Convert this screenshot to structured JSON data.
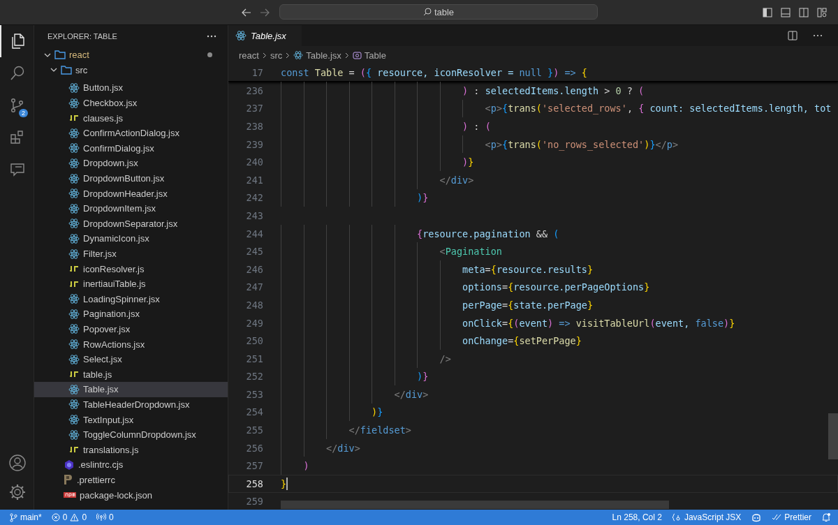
{
  "title_bar": {
    "search": {
      "value": "table"
    }
  },
  "activity_bar": {
    "items": [
      {
        "kind": "explorer",
        "selected": true
      },
      {
        "kind": "search",
        "selected": false
      },
      {
        "kind": "scm",
        "selected": false,
        "badge": "2"
      },
      {
        "kind": "extensions",
        "selected": false
      },
      {
        "kind": "remote",
        "selected": false
      }
    ],
    "bottom": [
      {
        "kind": "account"
      },
      {
        "kind": "settings"
      }
    ]
  },
  "sidebar": {
    "title": "EXPLORER: TABLE",
    "tree": [
      {
        "name": "react",
        "kind": "folder",
        "expanded": true,
        "modified": true,
        "selected": false,
        "children": [
          {
            "name": "src",
            "kind": "folder",
            "expanded": true,
            "selected": false,
            "children": [
              {
                "name": "Button.jsx",
                "kind": "react",
                "selected": false
              },
              {
                "name": "Checkbox.jsx",
                "kind": "react",
                "selected": false
              },
              {
                "name": "clauses.js",
                "kind": "js",
                "selected": false
              },
              {
                "name": "ConfirmActionDialog.jsx",
                "kind": "react",
                "selected": false
              },
              {
                "name": "ConfirmDialog.jsx",
                "kind": "react",
                "selected": false
              },
              {
                "name": "Dropdown.jsx",
                "kind": "react",
                "selected": false
              },
              {
                "name": "DropdownButton.jsx",
                "kind": "react",
                "selected": false
              },
              {
                "name": "DropdownHeader.jsx",
                "kind": "react",
                "selected": false
              },
              {
                "name": "DropdownItem.jsx",
                "kind": "react",
                "selected": false
              },
              {
                "name": "DropdownSeparator.jsx",
                "kind": "react",
                "selected": false
              },
              {
                "name": "DynamicIcon.jsx",
                "kind": "react",
                "selected": false
              },
              {
                "name": "Filter.jsx",
                "kind": "react",
                "selected": false
              },
              {
                "name": "iconResolver.js",
                "kind": "js",
                "selected": false
              },
              {
                "name": "inertiauiTable.js",
                "kind": "js",
                "selected": false
              },
              {
                "name": "LoadingSpinner.jsx",
                "kind": "react",
                "selected": false
              },
              {
                "name": "Pagination.jsx",
                "kind": "react",
                "selected": false
              },
              {
                "name": "Popover.jsx",
                "kind": "react",
                "selected": false
              },
              {
                "name": "RowActions.jsx",
                "kind": "react",
                "selected": false
              },
              {
                "name": "Select.jsx",
                "kind": "react",
                "selected": false
              },
              {
                "name": "table.js",
                "kind": "js",
                "selected": false
              },
              {
                "name": "Table.jsx",
                "kind": "react",
                "selected": true
              },
              {
                "name": "TableHeaderDropdown.jsx",
                "kind": "react",
                "selected": false
              },
              {
                "name": "TextInput.jsx",
                "kind": "react",
                "selected": false
              },
              {
                "name": "ToggleColumnDropdown.jsx",
                "kind": "react",
                "selected": false
              },
              {
                "name": "translations.js",
                "kind": "js",
                "selected": false
              }
            ]
          },
          {
            "name": ".eslintrc.cjs",
            "kind": "eslint",
            "selected": false
          },
          {
            "name": ".prettierrc",
            "kind": "prettier",
            "selected": false
          },
          {
            "name": "package-lock.json",
            "kind": "npm",
            "selected": false
          }
        ]
      }
    ]
  },
  "editor": {
    "tabs": [
      {
        "label": "Table.jsx",
        "kind": "react",
        "selected": true
      }
    ],
    "breadcrumbs": [
      {
        "label": "react",
        "kind": "folder"
      },
      {
        "label": "src",
        "kind": "folder"
      },
      {
        "label": "Table.jsx",
        "kind": "react"
      },
      {
        "label": "Table",
        "kind": "symbol"
      }
    ],
    "sticky_line": {
      "number": "17",
      "tokens": [
        {
          "t": "const ",
          "kind": "kw"
        },
        {
          "t": "Table",
          "kind": "fn"
        },
        {
          "t": " = ",
          "kind": "plain"
        },
        {
          "t": "(",
          "kind": "b2"
        },
        {
          "t": "{",
          "kind": "b3"
        },
        {
          "t": " resource, iconResolver = ",
          "kind": "var"
        },
        {
          "t": "null ",
          "kind": "kw"
        },
        {
          "t": "}",
          "kind": "b3"
        },
        {
          "t": ")",
          "kind": "b2"
        },
        {
          "t": " => ",
          "kind": "kw"
        },
        {
          "t": "{",
          "kind": "b1"
        }
      ]
    },
    "lines": [
      {
        "number": "236",
        "current": false,
        "tokens": [
          {
            "t": "                                )",
            "kind": "b2"
          },
          {
            "t": " : ",
            "kind": "plain"
          },
          {
            "t": "selectedItems.length",
            "kind": "var"
          },
          {
            "t": " > ",
            "kind": "plain"
          },
          {
            "t": "0",
            "kind": "num"
          },
          {
            "t": " ? ",
            "kind": "plain"
          },
          {
            "t": "(",
            "kind": "b2"
          }
        ]
      },
      {
        "number": "237",
        "current": false,
        "tokens": [
          {
            "t": "                                    <",
            "kind": "tag"
          },
          {
            "t": "p",
            "kind": "kw"
          },
          {
            "t": ">",
            "kind": "tag"
          },
          {
            "t": "{",
            "kind": "b3"
          },
          {
            "t": "trans",
            "kind": "fn"
          },
          {
            "t": "(",
            "kind": "b1"
          },
          {
            "t": "'selected_rows'",
            "kind": "str"
          },
          {
            "t": ", ",
            "kind": "plain"
          },
          {
            "t": "{",
            "kind": "b2"
          },
          {
            "t": " count: selectedItems.length, tot",
            "kind": "var"
          }
        ]
      },
      {
        "number": "238",
        "current": false,
        "tokens": [
          {
            "t": "                                )",
            "kind": "b2"
          },
          {
            "t": " : ",
            "kind": "plain"
          },
          {
            "t": "(",
            "kind": "b2"
          }
        ]
      },
      {
        "number": "239",
        "current": false,
        "tokens": [
          {
            "t": "                                    <",
            "kind": "tag"
          },
          {
            "t": "p",
            "kind": "kw"
          },
          {
            "t": ">",
            "kind": "tag"
          },
          {
            "t": "{",
            "kind": "b3"
          },
          {
            "t": "trans",
            "kind": "fn"
          },
          {
            "t": "(",
            "kind": "b1"
          },
          {
            "t": "'no_rows_selected'",
            "kind": "str"
          },
          {
            "t": ")",
            "kind": "b1"
          },
          {
            "t": "}",
            "kind": "b3"
          },
          {
            "t": "</",
            "kind": "tag"
          },
          {
            "t": "p",
            "kind": "kw"
          },
          {
            "t": ">",
            "kind": "tag"
          }
        ]
      },
      {
        "number": "240",
        "current": false,
        "tokens": [
          {
            "t": "                                )",
            "kind": "b2"
          },
          {
            "t": "}",
            "kind": "b1"
          }
        ]
      },
      {
        "number": "241",
        "current": false,
        "tokens": [
          {
            "t": "                            </",
            "kind": "tag"
          },
          {
            "t": "div",
            "kind": "kw"
          },
          {
            "t": ">",
            "kind": "tag"
          }
        ]
      },
      {
        "number": "242",
        "current": false,
        "tokens": [
          {
            "t": "                        )",
            "kind": "b3"
          },
          {
            "t": "}",
            "kind": "b2"
          }
        ]
      },
      {
        "number": "243",
        "current": false
      },
      {
        "number": "244",
        "current": false,
        "tokens": [
          {
            "t": "                        {",
            "kind": "b2"
          },
          {
            "t": "resource.pagination",
            "kind": "var"
          },
          {
            "t": " && ",
            "kind": "plain"
          },
          {
            "t": "(",
            "kind": "b3"
          }
        ]
      },
      {
        "number": "245",
        "current": false,
        "tokens": [
          {
            "t": "                            <",
            "kind": "tag"
          },
          {
            "t": "Pagination",
            "kind": "comp"
          }
        ]
      },
      {
        "number": "246",
        "current": false,
        "tokens": [
          {
            "t": "                                meta",
            "kind": "var"
          },
          {
            "t": "=",
            "kind": "plain"
          },
          {
            "t": "{",
            "kind": "b1"
          },
          {
            "t": "resource.results",
            "kind": "var"
          },
          {
            "t": "}",
            "kind": "b1"
          }
        ]
      },
      {
        "number": "247",
        "current": false,
        "tokens": [
          {
            "t": "                                options",
            "kind": "var"
          },
          {
            "t": "=",
            "kind": "plain"
          },
          {
            "t": "{",
            "kind": "b1"
          },
          {
            "t": "resource.perPageOptions",
            "kind": "var"
          },
          {
            "t": "}",
            "kind": "b1"
          }
        ]
      },
      {
        "number": "248",
        "current": false,
        "tokens": [
          {
            "t": "                                perPage",
            "kind": "var"
          },
          {
            "t": "=",
            "kind": "plain"
          },
          {
            "t": "{",
            "kind": "b1"
          },
          {
            "t": "state.perPage",
            "kind": "var"
          },
          {
            "t": "}",
            "kind": "b1"
          }
        ]
      },
      {
        "number": "249",
        "current": false,
        "tokens": [
          {
            "t": "                                onClick",
            "kind": "var"
          },
          {
            "t": "=",
            "kind": "plain"
          },
          {
            "t": "{",
            "kind": "b1"
          },
          {
            "t": "(",
            "kind": "b2"
          },
          {
            "t": "event",
            "kind": "var"
          },
          {
            "t": ")",
            "kind": "b2"
          },
          {
            "t": " => ",
            "kind": "kw"
          },
          {
            "t": "visitTableUrl",
            "kind": "fn"
          },
          {
            "t": "(",
            "kind": "b2"
          },
          {
            "t": "event, ",
            "kind": "var"
          },
          {
            "t": "false",
            "kind": "kw"
          },
          {
            "t": ")",
            "kind": "b2"
          },
          {
            "t": "}",
            "kind": "b1"
          }
        ]
      },
      {
        "number": "250",
        "current": false,
        "tokens": [
          {
            "t": "                                onChange",
            "kind": "var"
          },
          {
            "t": "=",
            "kind": "plain"
          },
          {
            "t": "{",
            "kind": "b1"
          },
          {
            "t": "setPerPage",
            "kind": "fn"
          },
          {
            "t": "}",
            "kind": "b1"
          }
        ]
      },
      {
        "number": "251",
        "current": false,
        "tokens": [
          {
            "t": "                            />",
            "kind": "tag"
          }
        ]
      },
      {
        "number": "252",
        "current": false,
        "tokens": [
          {
            "t": "                        )",
            "kind": "b3"
          },
          {
            "t": "}",
            "kind": "b2"
          }
        ]
      },
      {
        "number": "253",
        "current": false,
        "tokens": [
          {
            "t": "                    </",
            "kind": "tag"
          },
          {
            "t": "div",
            "kind": "kw"
          },
          {
            "t": ">",
            "kind": "tag"
          }
        ]
      },
      {
        "number": "254",
        "current": false,
        "tokens": [
          {
            "t": "                )",
            "kind": "b1"
          },
          {
            "t": "}",
            "kind": "b3"
          }
        ]
      },
      {
        "number": "255",
        "current": false,
        "tokens": [
          {
            "t": "            </",
            "kind": "tag"
          },
          {
            "t": "fieldset",
            "kind": "kw"
          },
          {
            "t": ">",
            "kind": "tag"
          }
        ]
      },
      {
        "number": "256",
        "current": false,
        "tokens": [
          {
            "t": "        </",
            "kind": "tag"
          },
          {
            "t": "div",
            "kind": "kw"
          },
          {
            "t": ">",
            "kind": "tag"
          }
        ]
      },
      {
        "number": "257",
        "current": false,
        "tokens": [
          {
            "t": "    )",
            "kind": "b2"
          }
        ]
      },
      {
        "number": "258",
        "current": true,
        "tokens": [
          {
            "t": "}",
            "kind": "b1"
          }
        ]
      },
      {
        "number": "259",
        "current": false
      }
    ]
  },
  "status_bar": {
    "branch": "main*",
    "errors": "0",
    "warnings": "0",
    "ports": "0",
    "position": "Ln 258, Col 2",
    "language": "JavaScript JSX",
    "formatter": "Prettier"
  }
}
